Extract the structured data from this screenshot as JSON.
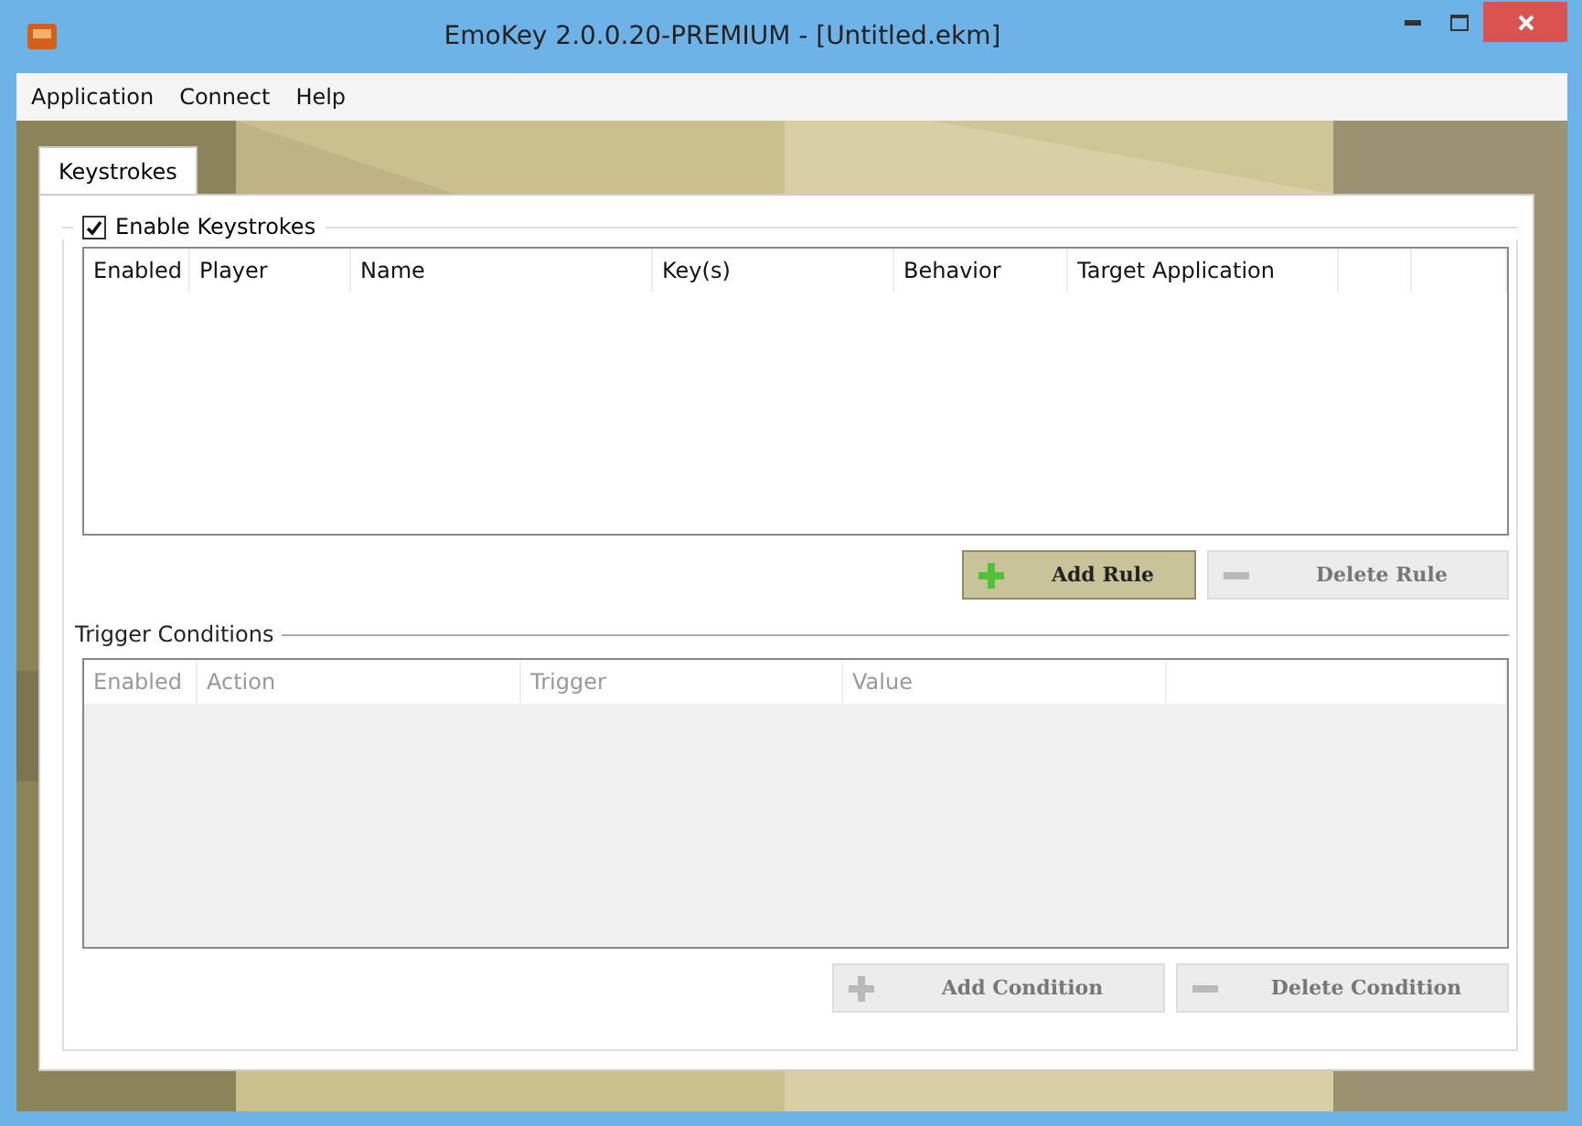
{
  "window": {
    "title": "EmoKey 2.0.0.20-PREMIUM - [Untitled.ekm]"
  },
  "menu": [
    "Application",
    "Connect",
    "Help"
  ],
  "tabs": [
    {
      "label": "Keystrokes",
      "selected": true
    }
  ],
  "keystrokes": {
    "enable_label": "Enable Keystrokes",
    "checked": true,
    "columns": [
      "Enabled",
      "Player",
      "Name",
      "Key(s)",
      "Behavior",
      "Target Application"
    ],
    "buttons": [
      {
        "label": "Add Rule",
        "kind": "add",
        "disabled": false
      },
      {
        "label": "Delete Rule",
        "kind": "delete",
        "disabled": true
      }
    ]
  },
  "trigger_conditions": {
    "title": "Trigger Conditions",
    "disabled": true,
    "columns": [
      "Enabled",
      "Action",
      "Trigger",
      "Value"
    ],
    "buttons": [
      {
        "label": "Add Condition",
        "kind": "add",
        "disabled": true
      },
      {
        "label": "Delete Condition",
        "kind": "delete",
        "disabled": true
      }
    ]
  }
}
